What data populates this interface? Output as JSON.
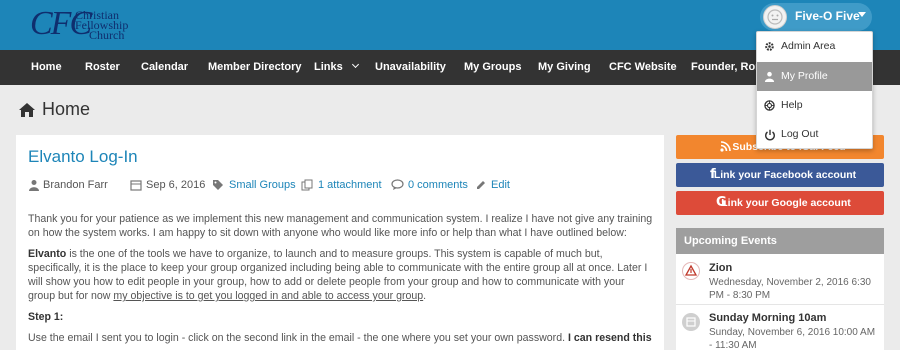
{
  "logo": {
    "mark": "CFC",
    "lines": [
      "Christian",
      "Fellowship",
      "Church"
    ]
  },
  "user": {
    "name": "Five-O Five",
    "avatar_icon": "avatar-face-icon"
  },
  "nav": [
    {
      "label": "Home"
    },
    {
      "label": "Roster"
    },
    {
      "label": "Calendar"
    },
    {
      "label": "Member Directory"
    },
    {
      "label": "Links"
    },
    {
      "label": "Unavailability"
    },
    {
      "label": "My Groups"
    },
    {
      "label": "My Giving"
    },
    {
      "label": "CFC Website"
    },
    {
      "label": "Founder, Ron C"
    }
  ],
  "page": {
    "title": "Home"
  },
  "post": {
    "title": "Elvanto Log-In",
    "author": "Brandon Farr",
    "date": "Sep 6, 2016",
    "category": "Small Groups",
    "attachments": "1 attachment",
    "comments": "0 comments",
    "edit": "Edit",
    "para1": "Thank you for your patience as we implement this new management and communication system. I realize I have not give any training on how the system works. I am happy to sit down with anyone who would like more info or help than what I have outlined below:",
    "para2_bold": "Elvanto",
    "para2_text": " is the one of the tools we have to organize, to launch and to measure groups.  This system is capable of much but, specifically, it is the place to keep your group organized including being able to communicate with the entire group all at once. Later I will show you how to edit people in your group, how to add or delete people from your group and how to communicate with your group but for now ",
    "para2_underline": "my objective is to get you logged in and able to access your group",
    "para2_end": ".",
    "step1": "Step 1:",
    "para3_text": "Use the email I sent you to login - click on the second link in the email - the one where you set your own password. ",
    "para3_bold": "I can resend this"
  },
  "sidebar": {
    "rss_label": "Subscribe to iCal Feed",
    "facebook_label": "Link your Facebook account",
    "google_label": "Link your Google account",
    "events_heading": "Upcoming Events",
    "events": [
      {
        "name": "Zion",
        "time": "Wednesday, November 2, 2016 6:30 PM - 8:30 PM"
      },
      {
        "name": "Sunday Morning 10am",
        "time": "Sunday, November 6, 2016 10:00 AM - 11:30 AM"
      }
    ]
  },
  "dropdown": {
    "items": [
      {
        "label": "Admin Area",
        "icon": "gear-icon"
      },
      {
        "label": "My Profile",
        "icon": "user-icon"
      },
      {
        "label": "Help",
        "icon": "lifebuoy-icon"
      },
      {
        "label": "Log Out",
        "icon": "power-icon"
      }
    ]
  },
  "colors": {
    "header": "#1d85b8",
    "nav": "#333333",
    "link": "#1d85b8",
    "rss": "#f2862e",
    "facebook": "#3b5998",
    "google": "#dd4b39"
  }
}
